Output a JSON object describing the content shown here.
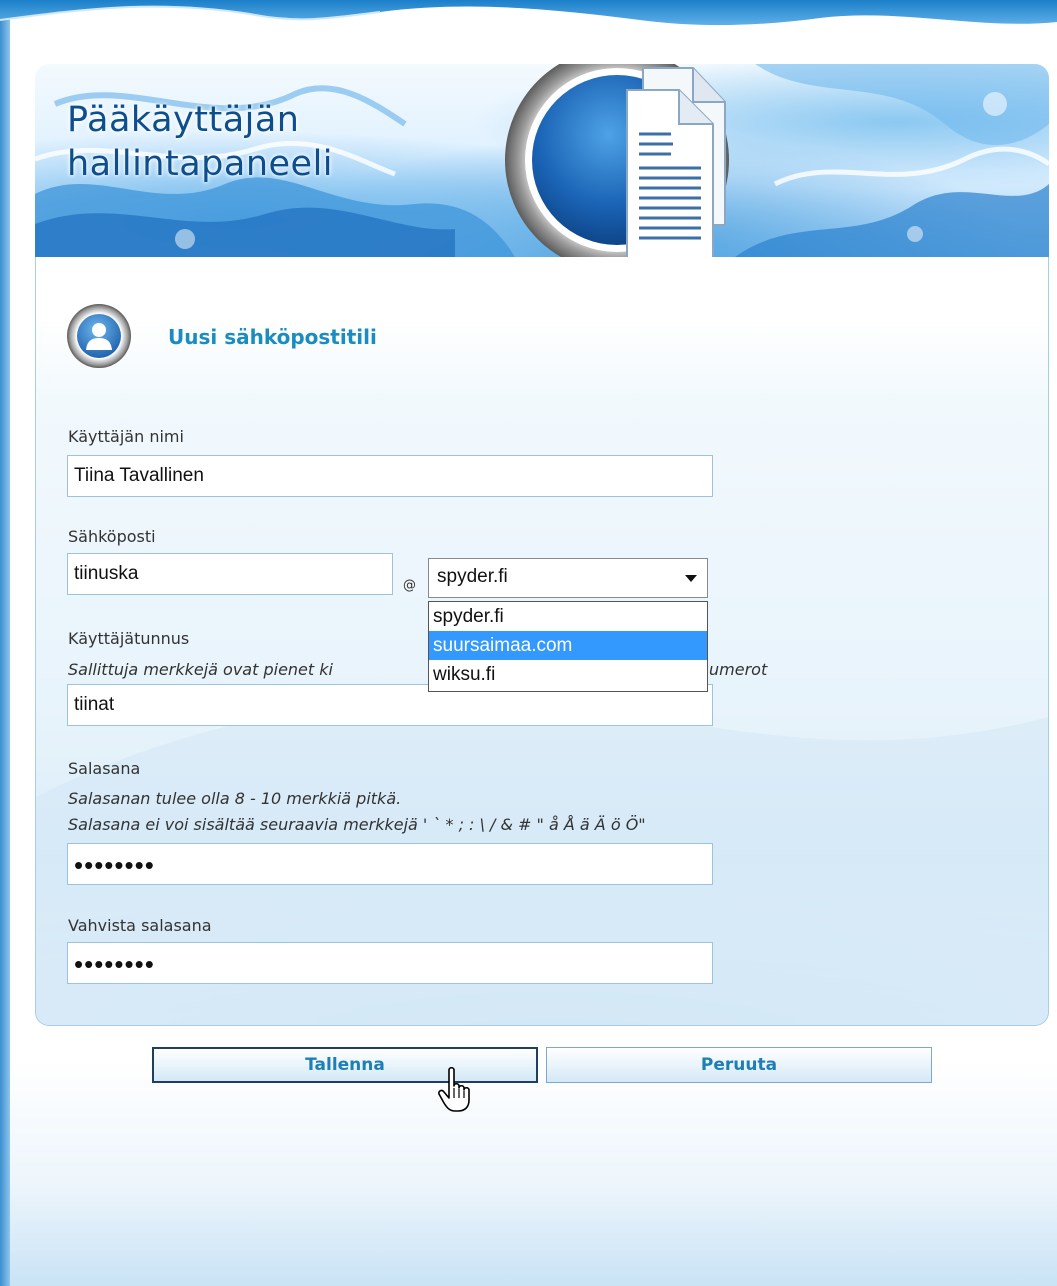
{
  "banner": {
    "title_line1": "Pääkäyttäjän",
    "title_line2": "hallintapaneeli"
  },
  "section": {
    "title": "Uusi sähköpostitili"
  },
  "form": {
    "username_label": "Käyttäjän nimi",
    "username_value": "Tiina Tavallinen",
    "email_label": "Sähköposti",
    "email_value": "tiinuska",
    "at_sign": "@",
    "domain_selected": "spyder.fi",
    "domain_options": [
      "spyder.fi",
      "suursaimaa.com",
      "wiksu.fi"
    ],
    "domain_highlighted_index": 1,
    "userid_label": "Käyttäjätunnus",
    "userid_hint_start": "Sallittuja merkkejä ovat pienet ki",
    "userid_hint_end": "umerot",
    "userid_value": "tiinat",
    "password_label": "Salasana",
    "password_hint1": "Salasanan tulee olla 8 - 10 merkkiä pitkä.",
    "password_hint2": "Salasana ei voi sisältää seuraavia merkkejä ' ` * ; : \\ / & # \" å Å ä Ä ö Ö\"",
    "password_value": "••••••••",
    "confirm_label": "Vahvista salasana",
    "confirm_value": "••••••••"
  },
  "buttons": {
    "save_label": "Tallenna",
    "cancel_label": "Peruuta"
  },
  "colors": {
    "accent": "#1b8cbf",
    "banner_title": "#0d4f8e",
    "highlight": "#3399ff"
  },
  "icons": [
    "document-icon",
    "user-icon",
    "hand-cursor-icon",
    "dropdown-arrow-icon"
  ]
}
